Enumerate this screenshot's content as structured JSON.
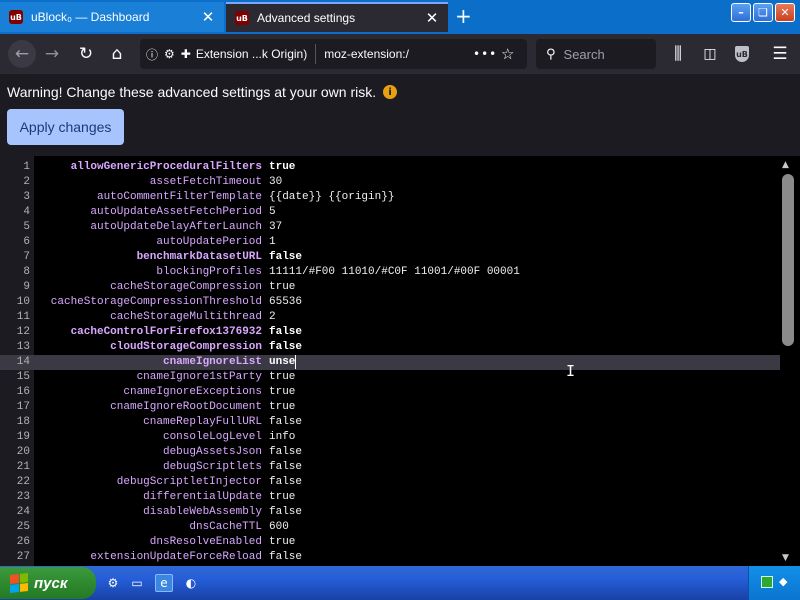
{
  "tabs": [
    {
      "title": "uBlock₀ — Dashboard",
      "favicon": "uB"
    },
    {
      "title": "Advanced settings",
      "favicon": "uB"
    }
  ],
  "new_tab": "+",
  "window_controls": {
    "minimize": "–",
    "maximize": "❏",
    "close": "✕"
  },
  "urlbar": {
    "identity_label": "Extension ...k Origin)",
    "url": "moz-extension:/",
    "more": "•••"
  },
  "search": {
    "placeholder": "Search"
  },
  "page": {
    "warning": "Warning! Change these advanced settings at your own risk.",
    "apply_label": "Apply changes"
  },
  "settings": [
    {
      "n": "1",
      "key": "allowGenericProceduralFilters",
      "value": "true",
      "modified": true
    },
    {
      "n": "2",
      "key": "assetFetchTimeout",
      "value": "30",
      "modified": false
    },
    {
      "n": "3",
      "key": "autoCommentFilterTemplate",
      "value": "{{date}} {{origin}}",
      "modified": false
    },
    {
      "n": "4",
      "key": "autoUpdateAssetFetchPeriod",
      "value": "5",
      "modified": false
    },
    {
      "n": "5",
      "key": "autoUpdateDelayAfterLaunch",
      "value": "37",
      "modified": false
    },
    {
      "n": "6",
      "key": "autoUpdatePeriod",
      "value": "1",
      "modified": false
    },
    {
      "n": "7",
      "key": "benchmarkDatasetURL",
      "value": "false",
      "modified": true
    },
    {
      "n": "8",
      "key": "blockingProfiles",
      "value": "11111/#F00 11010/#C0F 11001/#00F 00001",
      "modified": false
    },
    {
      "n": "9",
      "key": "cacheStorageCompression",
      "value": "true",
      "modified": false
    },
    {
      "n": "10",
      "key": "cacheStorageCompressionThreshold",
      "value": "65536",
      "modified": false
    },
    {
      "n": "11",
      "key": "cacheStorageMultithread",
      "value": "2",
      "modified": false
    },
    {
      "n": "12",
      "key": "cacheControlForFirefox1376932",
      "value": "false",
      "modified": true
    },
    {
      "n": "13",
      "key": "cloudStorageCompression",
      "value": "false",
      "modified": true
    },
    {
      "n": "14",
      "key": "cnameIgnoreList",
      "value": "unse",
      "modified": true
    },
    {
      "n": "15",
      "key": "cnameIgnore1stParty",
      "value": "true",
      "modified": false
    },
    {
      "n": "16",
      "key": "cnameIgnoreExceptions",
      "value": "true",
      "modified": false
    },
    {
      "n": "17",
      "key": "cnameIgnoreRootDocument",
      "value": "true",
      "modified": false
    },
    {
      "n": "18",
      "key": "cnameReplayFullURL",
      "value": "false",
      "modified": false
    },
    {
      "n": "19",
      "key": "consoleLogLevel",
      "value": "info",
      "modified": false
    },
    {
      "n": "20",
      "key": "debugAssetsJson",
      "value": "false",
      "modified": false
    },
    {
      "n": "21",
      "key": "debugScriptlets",
      "value": "false",
      "modified": false
    },
    {
      "n": "22",
      "key": "debugScriptletInjector",
      "value": "false",
      "modified": false
    },
    {
      "n": "23",
      "key": "differentialUpdate",
      "value": "true",
      "modified": false
    },
    {
      "n": "24",
      "key": "disableWebAssembly",
      "value": "false",
      "modified": false
    },
    {
      "n": "25",
      "key": "dnsCacheTTL",
      "value": "600",
      "modified": false
    },
    {
      "n": "26",
      "key": "dnsResolveEnabled",
      "value": "true",
      "modified": false
    },
    {
      "n": "27",
      "key": "extensionUpdateForceReload",
      "value": "false",
      "modified": false
    }
  ],
  "active_row": 14,
  "taskbar": {
    "start_label": "пуск"
  },
  "colors": {
    "accent": "#a7c4ff",
    "tabbar": "#0b6ec9",
    "key_text": "#d8a8ff",
    "warning_icon": "#e8a013"
  }
}
